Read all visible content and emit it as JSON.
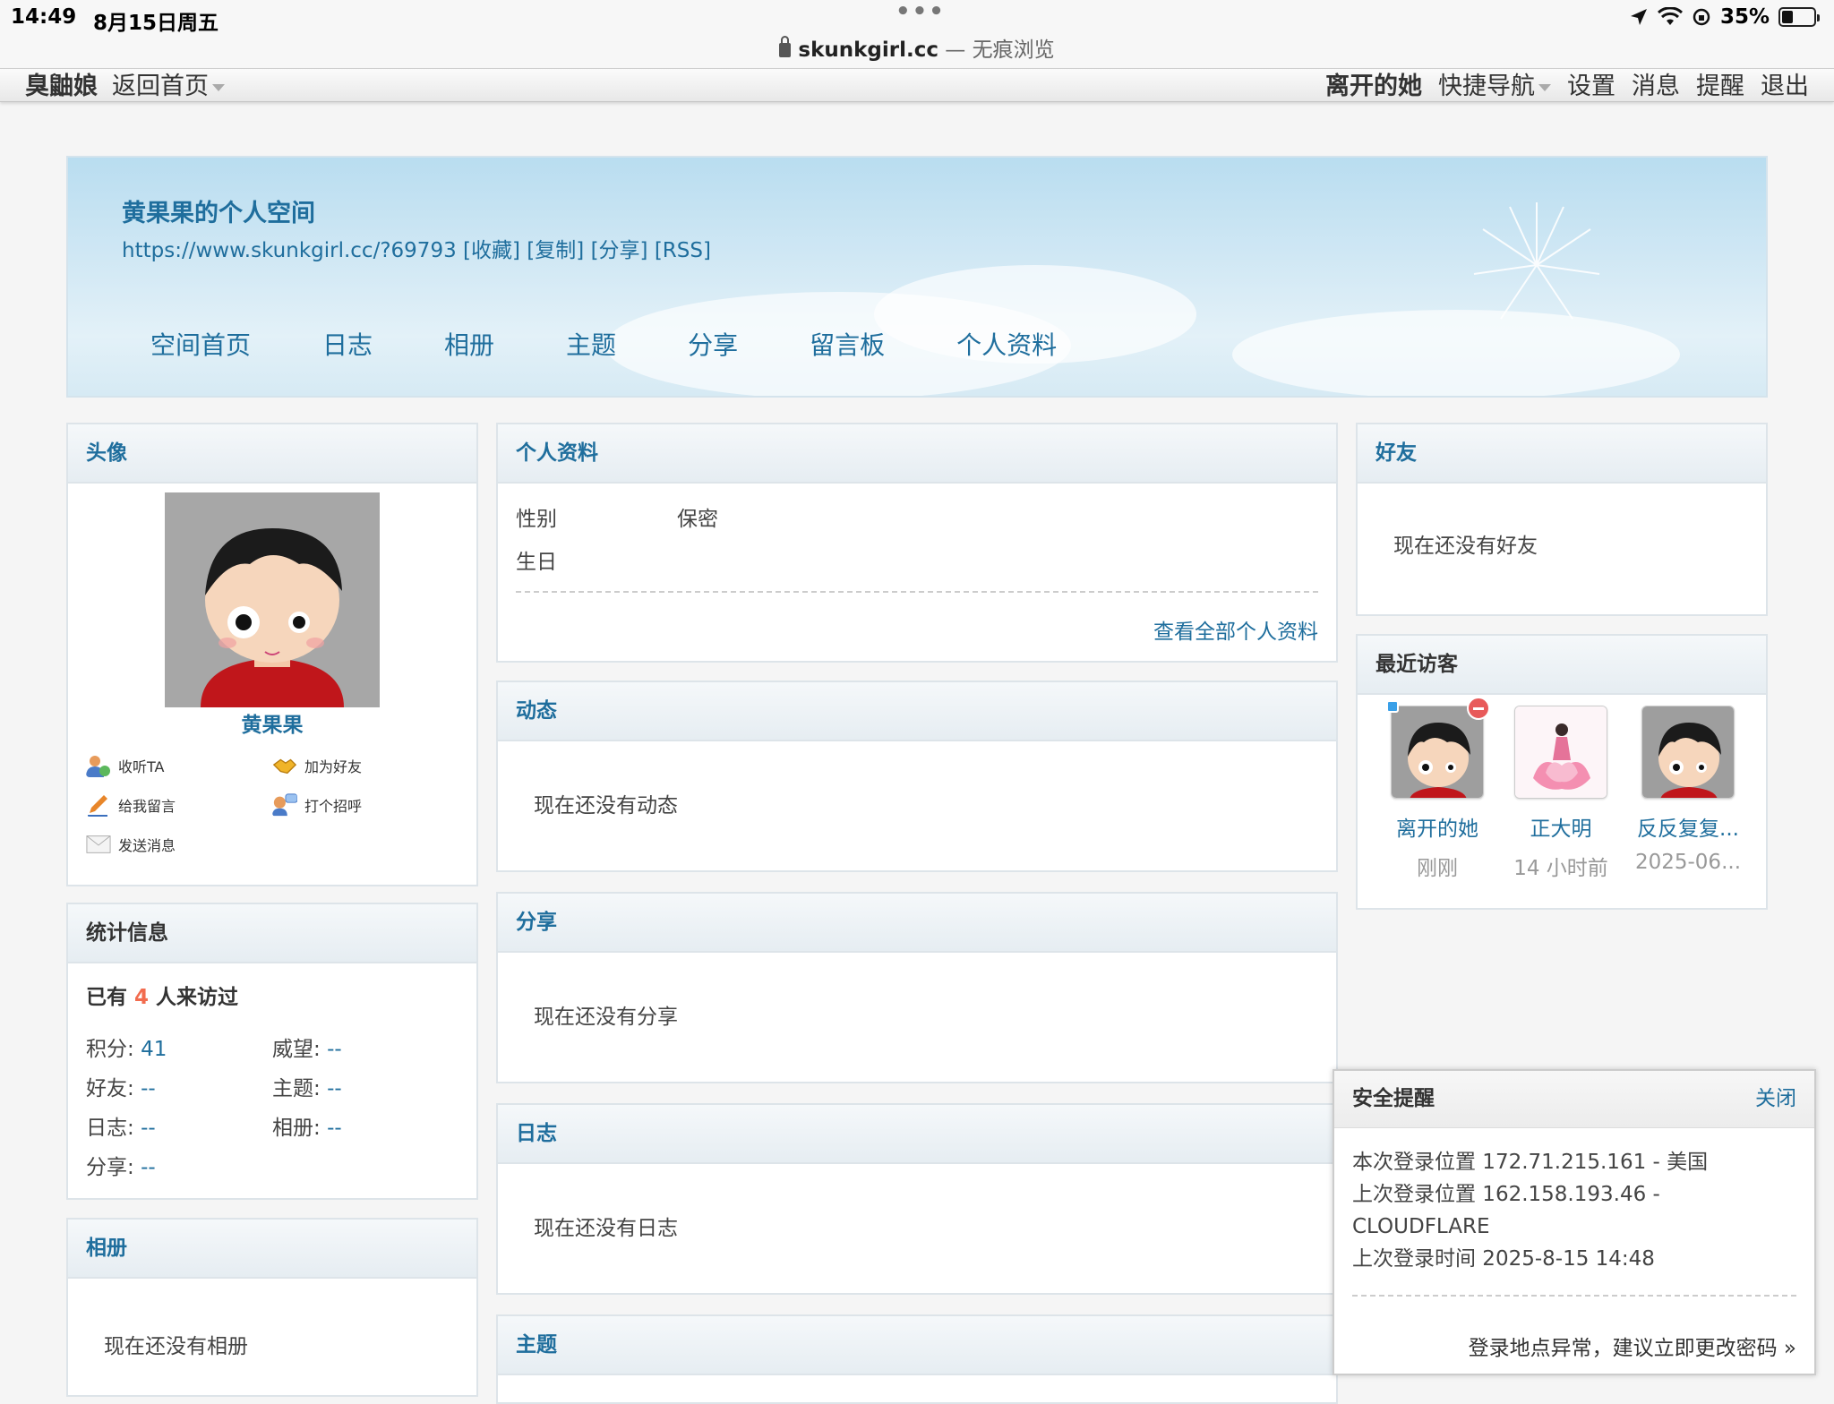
{
  "status_bar": {
    "time": "14:49",
    "date": "8月15日周五",
    "battery": "35%"
  },
  "url_bar": {
    "domain": "skunkgirl.cc",
    "mode": "— 无痕浏览"
  },
  "top_nav": {
    "site_name": "臭鼬娘",
    "back_home": "返回首页",
    "username": "离开的她",
    "quick_nav": "快捷导航",
    "settings": "设置",
    "messages": "消息",
    "reminders": "提醒",
    "logout": "退出"
  },
  "banner": {
    "title": "黄果果的个人空间",
    "url": "https://www.skunkgirl.cc/?69793",
    "links": [
      "[收藏]",
      "[复制]",
      "[分享]",
      "[RSS]"
    ],
    "nav": [
      "空间首页",
      "日志",
      "相册",
      "主题",
      "分享",
      "留言板",
      "个人资料"
    ]
  },
  "avatar_box": {
    "title": "头像",
    "name": "黄果果",
    "actions": [
      "收听TA",
      "加为好友",
      "给我留言",
      "打个招呼",
      "发送消息"
    ]
  },
  "stats_box": {
    "title": "统计信息",
    "visits_prefix": "已有",
    "visits_count": "4",
    "visits_suffix": "人来访过",
    "items": [
      {
        "label": "积分:",
        "value": "41"
      },
      {
        "label": "威望:",
        "value": "--"
      },
      {
        "label": "好友:",
        "value": "--"
      },
      {
        "label": "主题:",
        "value": "--"
      },
      {
        "label": "日志:",
        "value": "--"
      },
      {
        "label": "相册:",
        "value": "--"
      },
      {
        "label": "分享:",
        "value": "--"
      }
    ]
  },
  "album_box": {
    "title": "相册",
    "empty": "现在还没有相册"
  },
  "profile_box": {
    "title": "个人资料",
    "gender_label": "性别",
    "gender_value": "保密",
    "birthday_label": "生日",
    "view_all": "查看全部个人资料"
  },
  "feed_box": {
    "title": "动态",
    "empty": "现在还没有动态"
  },
  "share_box": {
    "title": "分享",
    "empty": "现在还没有分享"
  },
  "blog_box": {
    "title": "日志",
    "empty": "现在还没有日志"
  },
  "thread_box": {
    "title": "主题"
  },
  "friends_box": {
    "title": "好友",
    "empty": "现在还没有好友"
  },
  "visitors_box": {
    "title": "最近访客",
    "visitors": [
      {
        "name": "离开的她",
        "time": "刚刚"
      },
      {
        "name": "正大明",
        "time": "14 小时前"
      },
      {
        "name": "反反复复...",
        "time": "2025-06..."
      }
    ]
  },
  "security": {
    "title": "安全提醒",
    "close": "关闭",
    "line1": "本次登录位置 172.71.215.161 - 美国",
    "line2": "上次登录位置 162.158.193.46 -",
    "line3": "CLOUDFLARE",
    "line4": "上次登录时间 2025-8-15 14:48",
    "warning": "登录地点异常，建议立即更改密码 »"
  }
}
